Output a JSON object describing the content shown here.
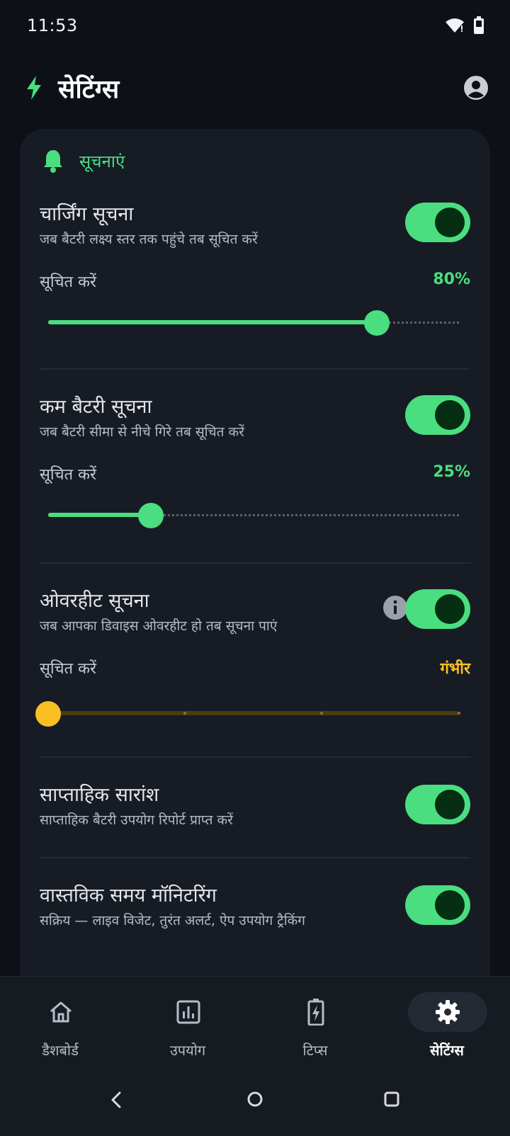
{
  "status": {
    "time": "11:53"
  },
  "app": {
    "title": "सेटिंग्स",
    "accent": "#4ade80",
    "warning": "#fbbf24"
  },
  "section": {
    "title": "सूचनाएं"
  },
  "settings": [
    {
      "title": "चार्जिंग सूचना",
      "subtitle": "जब बैटरी लक्ष्य स्तर तक पहुंचे तब सूचित करें",
      "enabled": true,
      "notify_label": "सूचित करें",
      "notify_value": "80%",
      "slider_fraction": 0.8
    },
    {
      "title": "कम बैटरी सूचना",
      "subtitle": "जब बैटरी सीमा से नीचे गिरे तब सूचित करें",
      "enabled": true,
      "notify_label": "सूचित करें",
      "notify_value": "25%",
      "slider_fraction": 0.25
    },
    {
      "title": "ओवरहीट सूचना",
      "subtitle": "जब आपका डिवाइस ओवरहीट हो तब सूचना पाएं",
      "enabled": true,
      "notify_label": "सूचित करें",
      "notify_value": "गंभीर",
      "slider_fraction": 0.0
    },
    {
      "title": "साप्ताहिक सारांश",
      "subtitle": "साप्ताहिक बैटरी उपयोग रिपोर्ट प्राप्त करें",
      "enabled": true
    },
    {
      "title": "वास्तविक समय मॉनिटरिंग",
      "subtitle": "सक्रिय — लाइव विजेट, तुरंत अलर्ट, ऐप उपयोग ट्रैकिंग",
      "enabled": true
    }
  ],
  "nav": {
    "items": [
      {
        "label": "डैशबोर्ड",
        "icon": "home-icon"
      },
      {
        "label": "उपयोग",
        "icon": "chart-icon"
      },
      {
        "label": "टिप्स",
        "icon": "battery-bolt-icon"
      },
      {
        "label": "सेटिंग्स",
        "icon": "gear-icon"
      }
    ],
    "active_index": 3
  }
}
